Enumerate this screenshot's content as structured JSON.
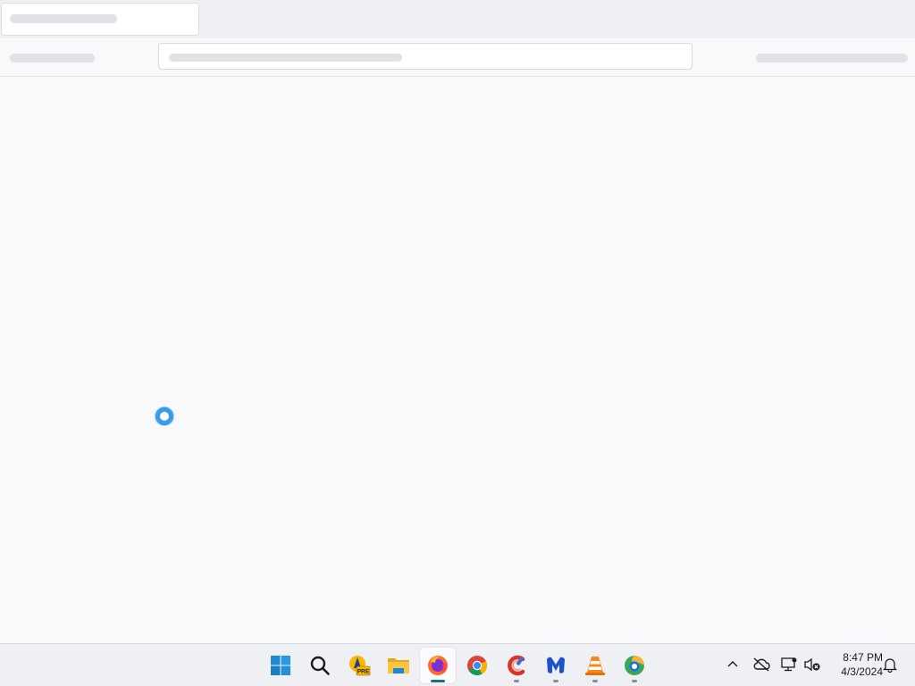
{
  "browser": {
    "tabs": [
      {
        "label": "",
        "active": true
      }
    ],
    "url_value": "",
    "loading": true
  },
  "taskbar": {
    "apps": [
      {
        "name": "start",
        "icon": "windows-logo-icon",
        "running": false,
        "active": false
      },
      {
        "name": "search",
        "icon": "search-icon",
        "running": false,
        "active": false
      },
      {
        "name": "acrobat-pre",
        "icon": "acrobat-pre-icon",
        "badge": "PRE",
        "running": false,
        "active": false
      },
      {
        "name": "file-explorer",
        "icon": "folder-icon",
        "running": false,
        "active": false
      },
      {
        "name": "firefox",
        "icon": "firefox-icon",
        "running": true,
        "active": true
      },
      {
        "name": "chrome",
        "icon": "chrome-icon",
        "running": false,
        "active": false
      },
      {
        "name": "ccleaner",
        "icon": "ccleaner-icon",
        "running": true,
        "active": false
      },
      {
        "name": "malwarebytes",
        "icon": "malwarebytes-icon",
        "running": true,
        "active": false
      },
      {
        "name": "vlc",
        "icon": "vlc-icon",
        "running": true,
        "active": false
      },
      {
        "name": "edge-dev",
        "icon": "edge-dev-icon",
        "running": true,
        "active": false
      }
    ],
    "tray": {
      "icons": [
        "chevron-up-icon",
        "cloud-offline-icon",
        "network-disconnected-icon",
        "speaker-muted-icon"
      ],
      "time": "8:47 PM",
      "date": "4/3/2024",
      "notification_icon": "bell-icon"
    }
  },
  "colors": {
    "accent": "#3a9be6",
    "active_indicator": "#1a6e86",
    "taskbar_bg": "#eef0f4"
  }
}
